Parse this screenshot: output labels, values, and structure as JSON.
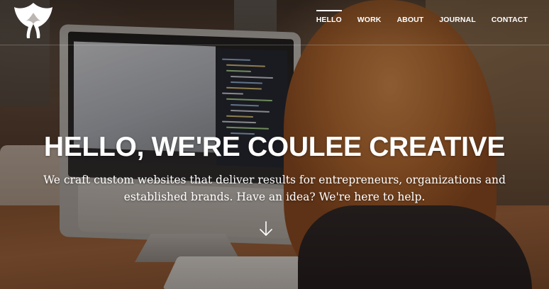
{
  "header": {
    "logo_icon": "leaf-drop-logo",
    "nav": [
      {
        "label": "HELLO",
        "active": true
      },
      {
        "label": "WORK",
        "active": false
      },
      {
        "label": "ABOUT",
        "active": false
      },
      {
        "label": "JOURNAL",
        "active": false
      },
      {
        "label": "CONTACT",
        "active": false
      }
    ]
  },
  "hero": {
    "headline": "HELLO, WE'RE COULEE CREATIVE",
    "subtext_line1": "We craft custom websites that deliver results for entrepreneurs, organizations and",
    "subtext_line2": "established brands. Have an idea? We're here to help.",
    "scroll_icon": "arrow-down-icon"
  },
  "colors": {
    "text": "#ffffff",
    "overlay": "#140e0a"
  }
}
